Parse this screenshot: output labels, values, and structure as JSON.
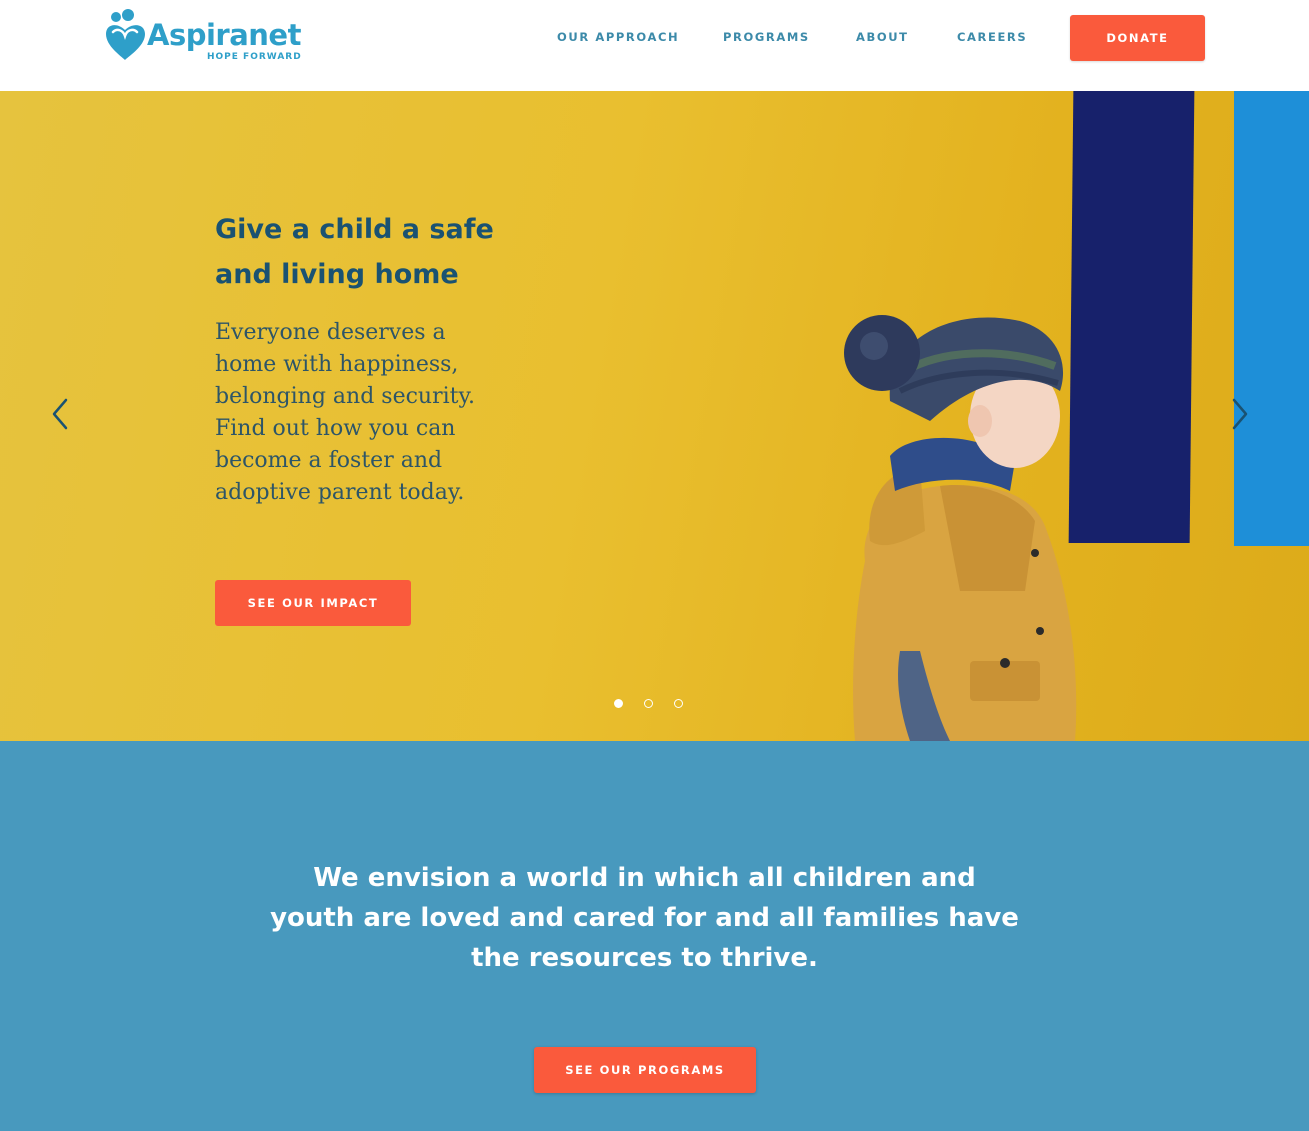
{
  "brand": {
    "name": "Aspiranet",
    "tagline": "HOPE FORWARD",
    "colors": {
      "primary": "#2e9fc9",
      "accent": "#fa5a3c",
      "navy_text": "#1a5272",
      "hero_yellow": "#e9bf2f",
      "section_blue": "#4899be"
    }
  },
  "nav": {
    "items": [
      {
        "label": "OUR APPROACH"
      },
      {
        "label": "PROGRAMS"
      },
      {
        "label": "ABOUT"
      },
      {
        "label": "CAREERS"
      }
    ],
    "donate_label": "DONATE"
  },
  "hero": {
    "title": "Give a child a safe and living home",
    "body": "Everyone deserves a home with happiness, belonging and security. Find out how you can become a foster and adoptive parent today.",
    "cta_label": "SEE OUR IMPACT",
    "prev_icon": "chevron-left-icon",
    "next_icon": "chevron-right-icon",
    "slides_total": 3,
    "active_slide": 1,
    "image_subject": "child-in-knit-hat-and-yellow-raincoat"
  },
  "vision": {
    "text": "We envision a world in which all children and youth are loved and cared for and all families have the resources to thrive.",
    "cta_label": "SEE OUR PROGRAMS"
  }
}
